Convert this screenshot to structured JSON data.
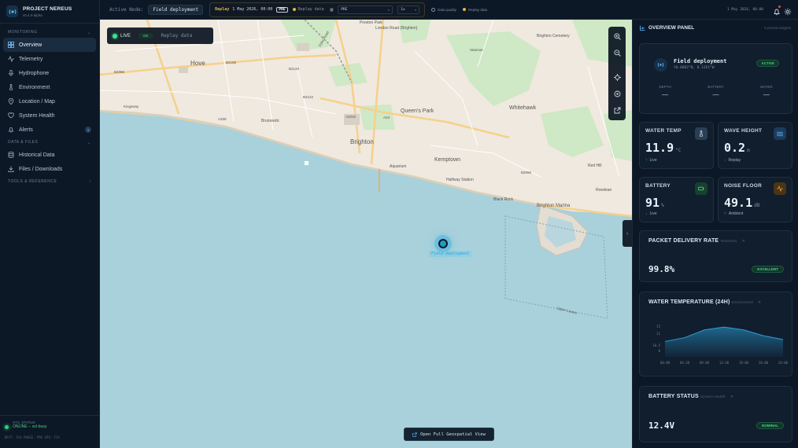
{
  "app": {
    "name": "PROJECT NEREUS",
    "version": "v0.4.0-alpha"
  },
  "sidebar": {
    "sections": [
      {
        "label": "MONITORING",
        "items": [
          {
            "label": "Overview",
            "icon": "grid-icon",
            "active": true
          },
          {
            "label": "Telemetry",
            "icon": "activity-icon"
          },
          {
            "label": "Hydrophone",
            "icon": "microphone-icon"
          },
          {
            "label": "Environment",
            "icon": "thermometer-icon"
          },
          {
            "label": "Location / Map",
            "icon": "map-pin-icon"
          },
          {
            "label": "System Health",
            "icon": "heart-icon"
          },
          {
            "label": "Alerts",
            "icon": "bell-icon",
            "badge": "1"
          }
        ]
      },
      {
        "label": "DATA & FILES",
        "items": [
          {
            "label": "Historical Data",
            "icon": "database-icon"
          },
          {
            "label": "Files / Downloads",
            "icon": "download-icon"
          }
        ]
      },
      {
        "label": "TOOLS & REFERENCE",
        "items": []
      }
    ],
    "sys_status": {
      "label": "SYS_STATUS",
      "value": "ONLINE -- ocl-busy",
      "footer": "BATT: 91%   PHASE: PRE   GPS: FIX"
    }
  },
  "topbar": {
    "active_node_label": "Active Node:",
    "active_node": "Field deployment",
    "replay_title": "Replay",
    "replay_date": "1 May 2026, 00:00",
    "replay_chip": "PRE",
    "replay_data_label": "Replay data",
    "phase_select": "PRE",
    "speed_select": "1x",
    "legend_quality": "Data quality",
    "legend_replay": "Replay data",
    "date": "1 May 2026, 00:00"
  },
  "map": {
    "live_label": "LIVE",
    "ok_label": "OK",
    "replay_label": "Replay data",
    "labels": [
      "London Road (Brighton)",
      "Hove",
      "Brighton",
      "Queen's Park",
      "Kemptown",
      "Whitehawk",
      "Brighton Marina",
      "Black Rock",
      "Halfway Station",
      "Aquarium",
      "Brunswick",
      "Preston Park",
      "Red Hill",
      "Roedean",
      "Brighton Cemetery",
      "Kingsway",
      "Dyke Road",
      "Stanmer",
      "B2066",
      "B2122",
      "A259",
      "A23",
      "A2010",
      "B2185",
      "B2120",
      "B2066",
      "Upper Lewes"
    ],
    "marker_label": "Field deployment",
    "geo_button": "Open Full Geospatial View",
    "colors": {
      "sea": "#a9d1dc",
      "land": "#efe9df",
      "park": "#bfe3b4",
      "road": "#f7d08a"
    }
  },
  "panel": {
    "title": "OVERVIEW PANEL",
    "hint": "5 pinned widgets",
    "device": {
      "name": "Field deployment",
      "coords": "50.8082°N, 0.1261°W",
      "status": "ACTIVE",
      "stats": [
        {
          "label": "DEPTH",
          "value": "—"
        },
        {
          "label": "BATTERY",
          "value": "—"
        },
        {
          "label": "WATER",
          "value": "—"
        }
      ]
    },
    "metrics": [
      {
        "title": "WATER TEMP",
        "value": "11.9",
        "unit": "°C",
        "sub": "Live",
        "arrow": "↑",
        "icon": "thermometer-icon",
        "color": "#2a3e55"
      },
      {
        "title": "WAVE HEIGHT",
        "value": "0.2",
        "unit": "m",
        "sub": "Replay",
        "arrow": "↓",
        "icon": "waves-icon",
        "color": "#1d3b5c"
      },
      {
        "title": "BATTERY",
        "value": "91",
        "unit": "%",
        "sub": "Live",
        "arrow": "↓",
        "icon": "battery-icon",
        "color": "#17402e"
      },
      {
        "title": "NOISE FLOOR",
        "value": "49.1",
        "unit": "dB",
        "sub": "Ambient",
        "arrow": "~",
        "icon": "pulse-icon",
        "color": "#4a3416"
      }
    ],
    "packet": {
      "title": "PACKET DELIVERY RATE",
      "tag": "Telemetry",
      "value": "99.8%",
      "status": "EXCELLENT"
    },
    "temp_chart": {
      "title": "WATER TEMPERATURE (24H)",
      "tag": "Environment"
    },
    "battery": {
      "title": "BATTERY STATUS",
      "tag": "System Health",
      "value": "12.4V",
      "status": "NOMINAL"
    }
  },
  "chart_data": {
    "type": "area",
    "x": [
      "00:00",
      "04:30",
      "09:00",
      "13:30",
      "18:00",
      "20:00",
      "24:00"
    ],
    "y": [
      11.4,
      11.6,
      12.0,
      12.15,
      12.0,
      11.7,
      11.5
    ],
    "yticks": [
      "12",
      "11",
      "10.5",
      "0"
    ],
    "title": "WATER TEMPERATURE (24H)",
    "color": "#2aa0d8"
  }
}
